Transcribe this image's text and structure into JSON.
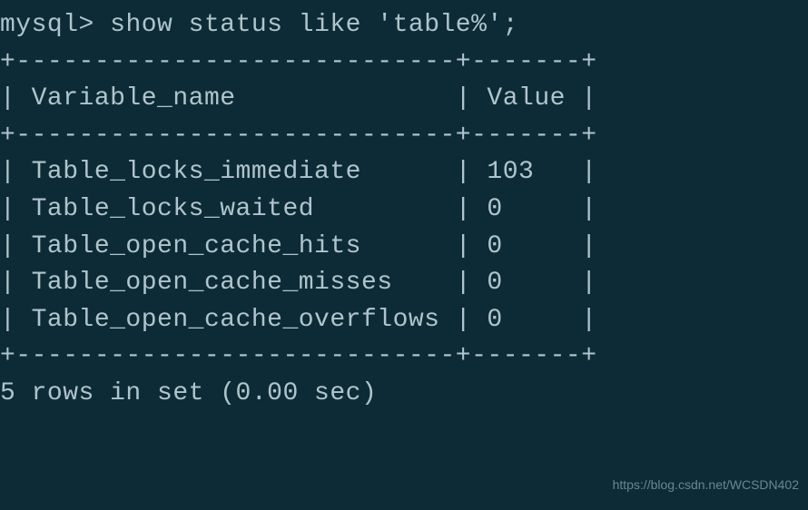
{
  "prompt": "mysql>",
  "command": "show status like 'table%';",
  "table": {
    "border_top": "+----------------------------+-------+",
    "border_mid": "+----------------------------+-------+",
    "border_bottom": "+----------------------------+-------+",
    "header": {
      "col1": "Variable_name",
      "col2": "Value"
    },
    "rows": [
      {
        "col1": "Table_locks_immediate",
        "col2": "103"
      },
      {
        "col1": "Table_locks_waited",
        "col2": "0"
      },
      {
        "col1": "Table_open_cache_hits",
        "col2": "0"
      },
      {
        "col1": "Table_open_cache_misses",
        "col2": "0"
      },
      {
        "col1": "Table_open_cache_overflows",
        "col2": "0"
      }
    ]
  },
  "footer": "5 rows in set (0.00 sec)",
  "watermark": "https://blog.csdn.net/WCSDN402"
}
